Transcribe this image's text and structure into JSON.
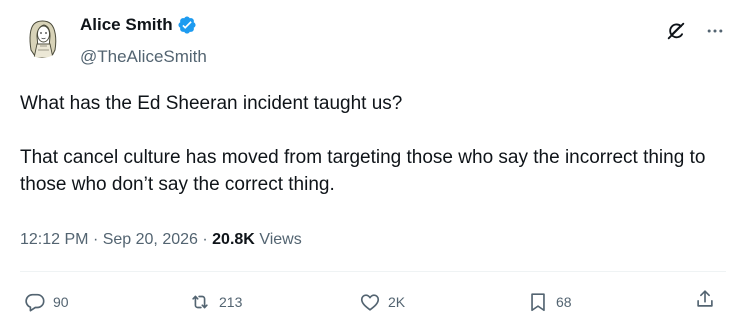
{
  "author": {
    "display_name": "Alice Smith",
    "handle": "@TheAliceSmith",
    "verified": true,
    "verified_color": "#1d9bf0"
  },
  "tweet": {
    "paragraphs": [
      "What has the Ed Sheeran incident taught us?",
      "That cancel culture has moved from targeting those who say the incorrect thing to those who don’t say the correct thing."
    ]
  },
  "meta": {
    "time": "12:12 PM",
    "separator": "·",
    "date": "Sep 20, 2026",
    "views_count": "20.8K",
    "views_label": "Views"
  },
  "actions": {
    "reply_count": "90",
    "retweet_count": "213",
    "like_count": "2K",
    "bookmark_count": "68"
  },
  "icons": {
    "top": [
      "grok-icon",
      "more-icon"
    ],
    "actions": [
      "reply-icon",
      "retweet-icon",
      "like-icon",
      "bookmark-icon",
      "share-icon"
    ]
  },
  "colors": {
    "text_primary": "#0f1419",
    "text_secondary": "#536471",
    "divider": "#eff3f4"
  }
}
